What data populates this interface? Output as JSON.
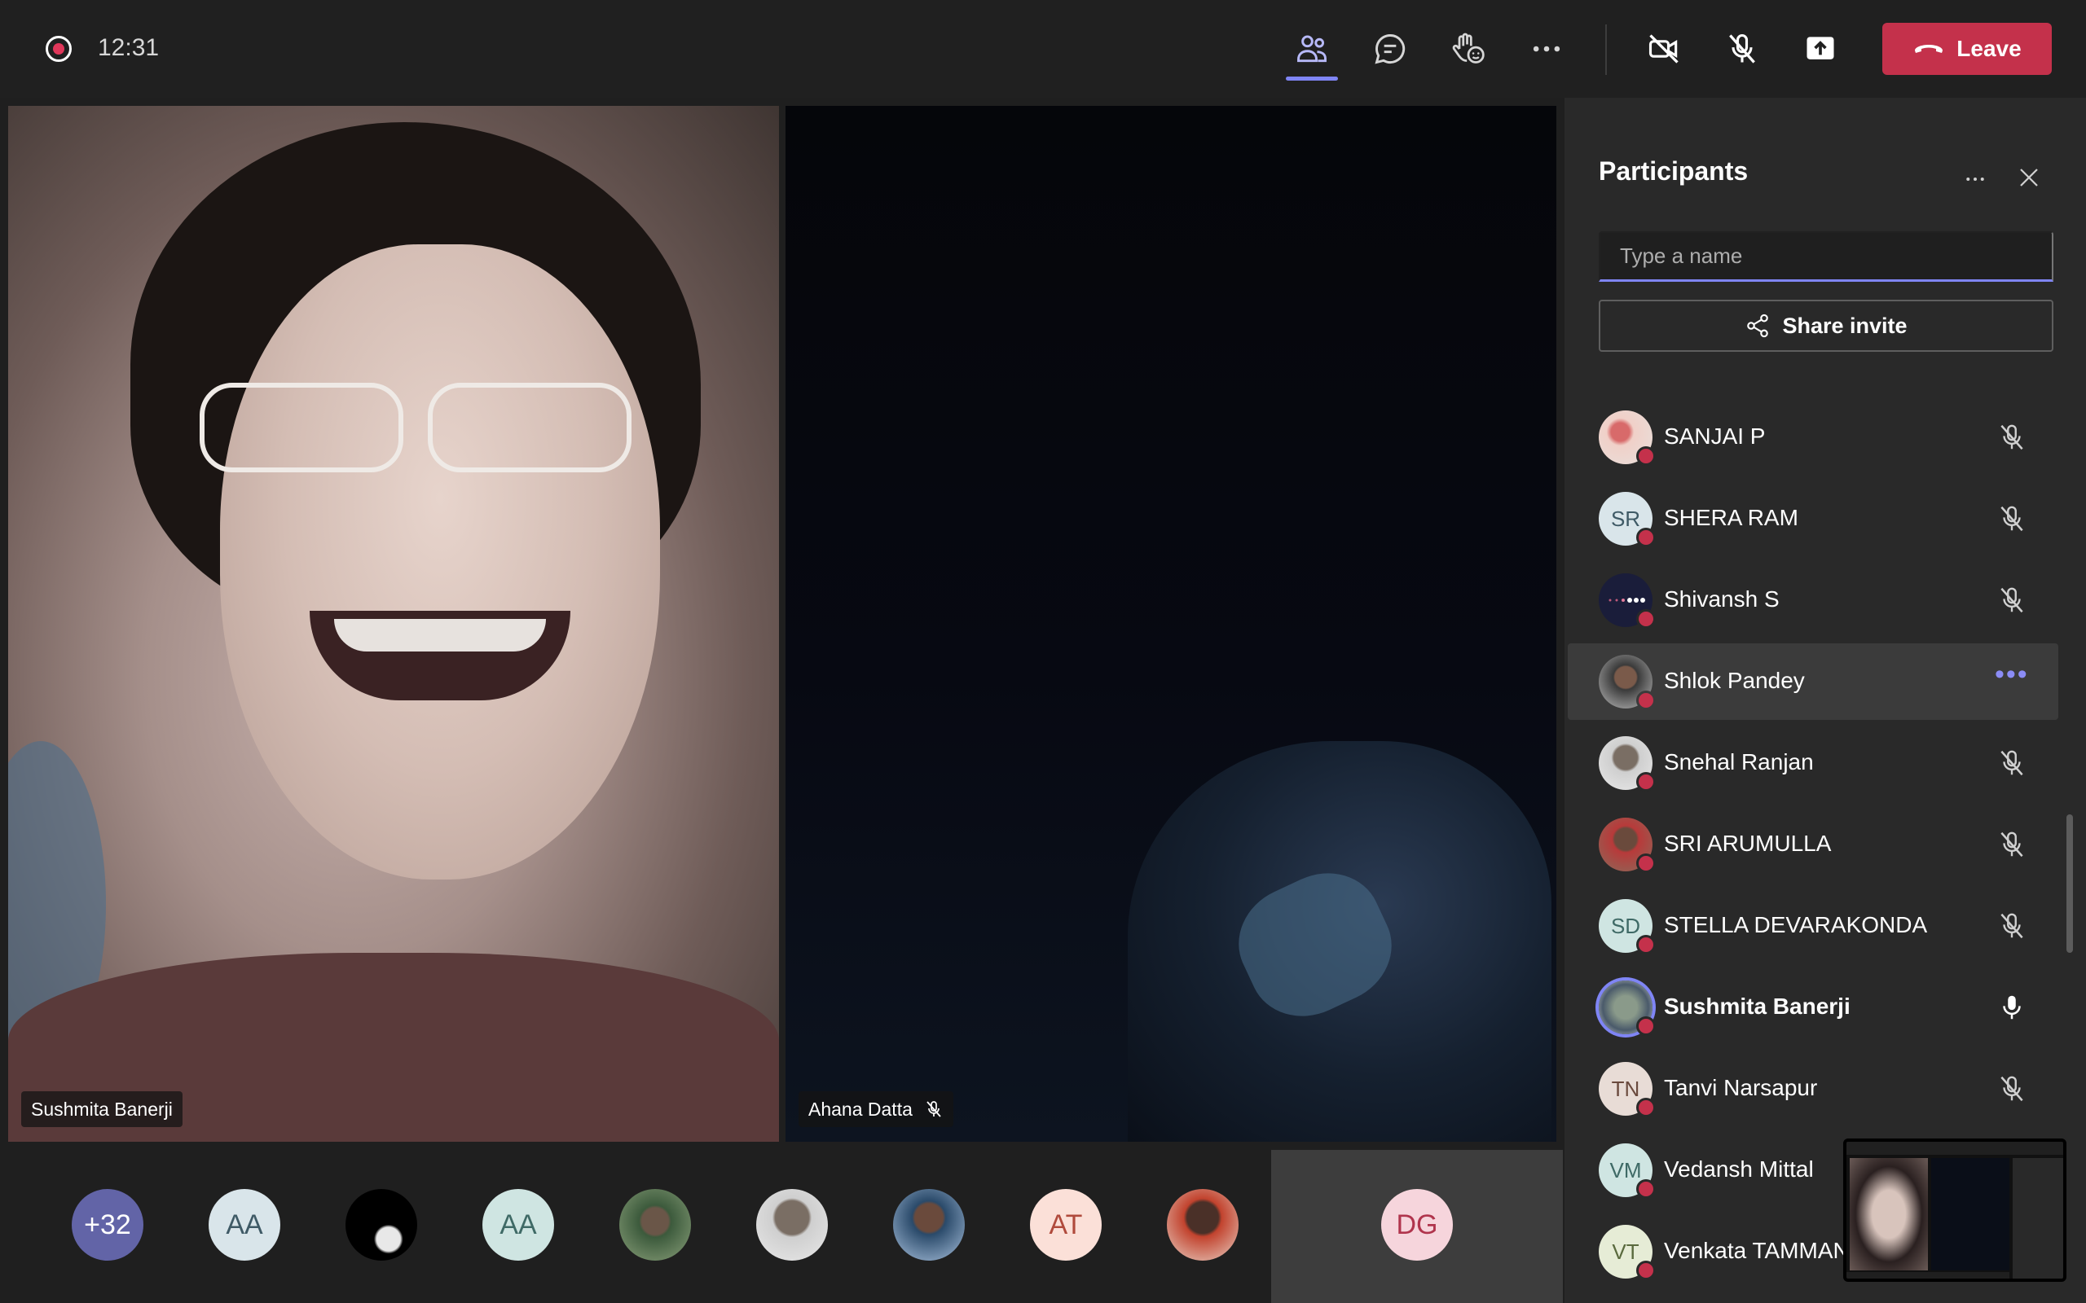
{
  "header": {
    "timer": "12:31",
    "leave_label": "Leave"
  },
  "videos": [
    {
      "name": "Sushmita Banerji",
      "muted": false
    },
    {
      "name": "Ahana Datta",
      "muted": true
    }
  ],
  "strip": {
    "overflow_count": "+32",
    "avatars": [
      "AA",
      "AA",
      "AT",
      "DG"
    ]
  },
  "panel": {
    "title": "Participants",
    "search_placeholder": "Type a name",
    "share_invite_label": "Share invite",
    "participants": [
      {
        "name": "SANJAI P",
        "initials": "",
        "mic": "muted"
      },
      {
        "name": "SHERA RAM",
        "initials": "SR",
        "mic": "muted"
      },
      {
        "name": "Shivansh S",
        "initials": "",
        "mic": "muted"
      },
      {
        "name": "Shlok Pandey",
        "initials": "",
        "mic": "more"
      },
      {
        "name": "Snehal Ranjan",
        "initials": "",
        "mic": "muted"
      },
      {
        "name": "SRI ARUMULLA",
        "initials": "",
        "mic": "muted"
      },
      {
        "name": "STELLA DEVARAKONDA",
        "initials": "SD",
        "mic": "muted"
      },
      {
        "name": "Sushmita Banerji",
        "initials": "",
        "mic": "on"
      },
      {
        "name": "Tanvi Narsapur",
        "initials": "TN",
        "mic": "muted"
      },
      {
        "name": "Vedansh Mittal",
        "initials": "VM",
        "mic": "none"
      },
      {
        "name": "Venkata TAMMAN",
        "initials": "VT",
        "mic": "none"
      }
    ]
  },
  "colors": {
    "accent": "#7f85f5",
    "leave": "#c4314b",
    "status_red": "#c4314b"
  }
}
